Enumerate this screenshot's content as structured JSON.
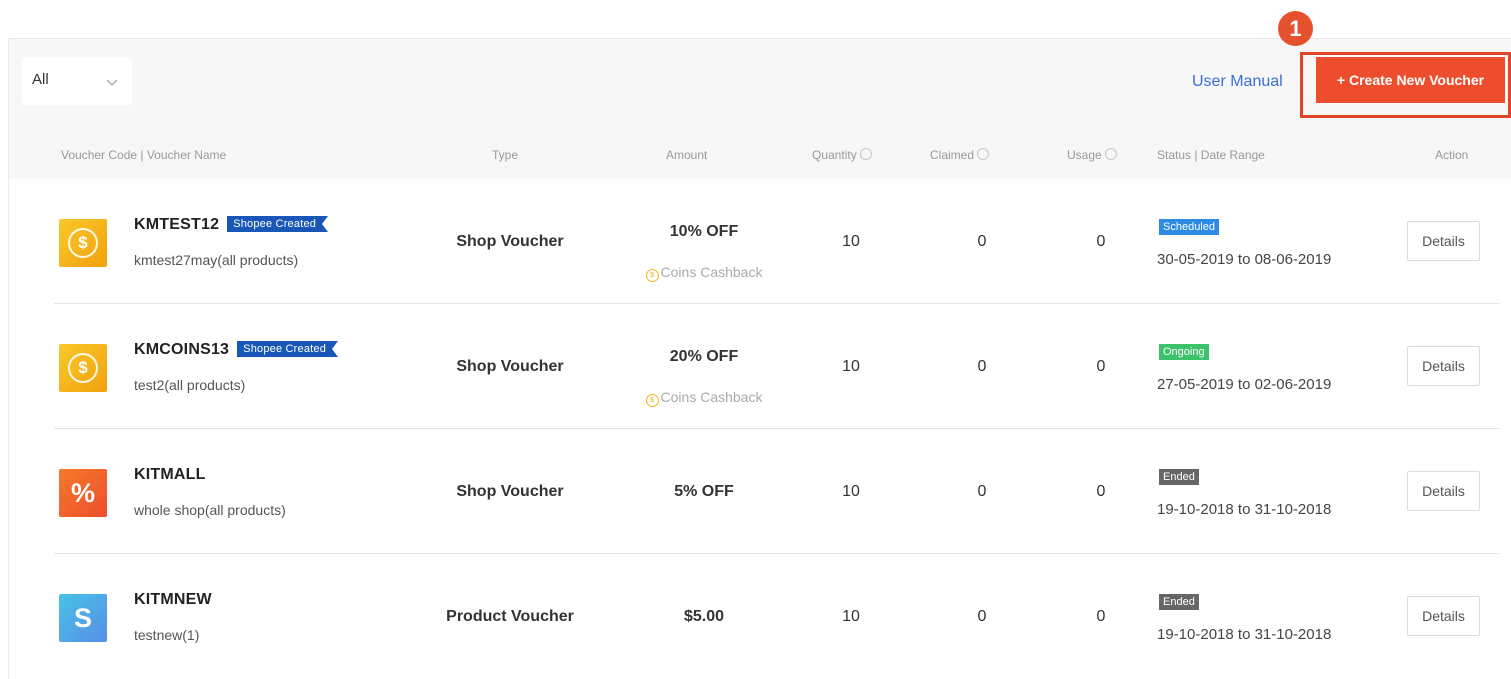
{
  "filter": {
    "selected": "All"
  },
  "header_links": {
    "user_manual": "User Manual",
    "create_button": "+ Create New Voucher",
    "step_number": "1"
  },
  "columns": {
    "voucher": "Voucher Code  |  Voucher Name",
    "type": "Type",
    "amount": "Amount",
    "quantity": "Quantity",
    "claimed": "Claimed",
    "usage": "Usage",
    "status": "Status  |  Date Range",
    "action": "Action"
  },
  "rows": [
    {
      "icon": "coin-icon",
      "code": "KMTEST12",
      "tag": "Shopee Created",
      "name": "kmtest27may(all products)",
      "type": "Shop Voucher",
      "amount": "10% OFF",
      "cashback": "Coins Cashback",
      "quantity": "10",
      "claimed": "0",
      "usage": "0",
      "status": "Scheduled",
      "date_range": "30-05-2019 to 08-06-2019",
      "action": "Details"
    },
    {
      "icon": "coin-icon",
      "code": "KMCOINS13",
      "tag": "Shopee Created",
      "name": "test2(all products)",
      "type": "Shop Voucher",
      "amount": "20% OFF",
      "cashback": "Coins Cashback",
      "quantity": "10",
      "claimed": "0",
      "usage": "0",
      "status": "Ongoing",
      "date_range": "27-05-2019 to 02-06-2019",
      "action": "Details"
    },
    {
      "icon": "percent-icon",
      "code": "KITMALL",
      "tag": "",
      "name": "whole shop(all products)",
      "type": "Shop Voucher",
      "amount": "5% OFF",
      "cashback": "",
      "quantity": "10",
      "claimed": "0",
      "usage": "0",
      "status": "Ended",
      "date_range": "19-10-2018 to 31-10-2018",
      "action": "Details"
    },
    {
      "icon": "dollar-icon",
      "code": "KITMNEW",
      "tag": "",
      "name": "testnew(1)",
      "type": "Product Voucher",
      "amount": "$5.00",
      "cashback": "",
      "quantity": "10",
      "claimed": "0",
      "usage": "0",
      "status": "Ended",
      "date_range": "19-10-2018 to 31-10-2018",
      "action": "Details"
    }
  ],
  "glyphs": {
    "coin": "$",
    "percent": "%",
    "dollar": "S",
    "cashback_coin": "$"
  },
  "colors": {
    "brand": "#ee4d2d",
    "link": "#3b6fd6",
    "scheduled": "#2d8be4",
    "ongoing": "#3cc26a",
    "ended": "#666666",
    "shopee_tag": "#1857b8"
  }
}
